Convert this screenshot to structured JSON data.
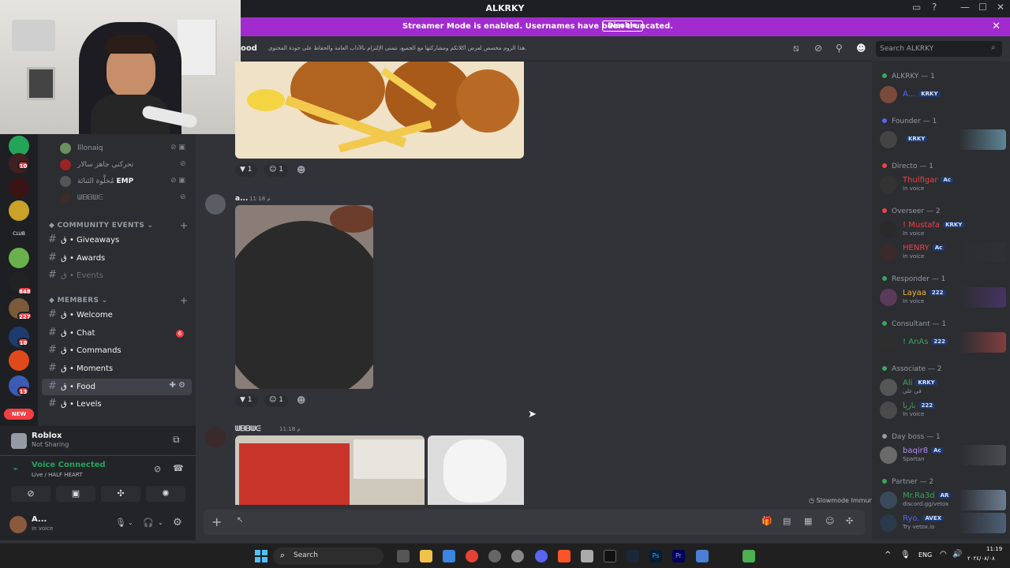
{
  "window": {
    "title": "ALKRKY"
  },
  "streamer_banner": {
    "text": "Streamer Mode is enabled. Usernames have been truncated.",
    "button": "Disable"
  },
  "channel_header": {
    "name": "ood",
    "topic": "هذا الروم مخصص لعرض أكلاتكم ومشاركتها مع الجميع، نتمنى الإلتزام بالآداب العامة والحفاظ على جودة المحتوى.",
    "search_placeholder": "Search ALKRKY"
  },
  "guild_badges": [
    "10",
    "848",
    "227",
    "18",
    "13"
  ],
  "guild_new": "NEW",
  "voice_users": [
    {
      "name": "lllonaiq"
    },
    {
      "name": "تحركني جاهز سالار"
    },
    {
      "name": "مُخلَّوة الثنائة",
      "tag": "EMP"
    },
    {
      "name": "ᗯᗷᗷᗯᕮ"
    }
  ],
  "categories": {
    "community": "COMMUNITY EVENTS",
    "members": "MEMBERS"
  },
  "community_channels": [
    {
      "name": "Giveaways"
    },
    {
      "name": "Awards"
    },
    {
      "name": "Events"
    }
  ],
  "member_channels": [
    {
      "name": "Welcome"
    },
    {
      "name": "Chat",
      "badge": "6"
    },
    {
      "name": "Commands"
    },
    {
      "name": "Moments"
    },
    {
      "name": "Food"
    },
    {
      "name": "Levels"
    }
  ],
  "channel_prefix": "ق •",
  "activity": {
    "game": "Roblox",
    "status": "Not Sharing"
  },
  "voice": {
    "status": "Voice Connected",
    "detail": "Live / HALF HEART"
  },
  "user_panel": {
    "name": "A...",
    "status": "In voice"
  },
  "messages": [
    {
      "author": "a...",
      "time": "11:18 م",
      "reactions": [
        "1",
        "1"
      ]
    },
    {
      "author": "ᗯᗷᗷᗯᕮ",
      "time": "11:18 م"
    }
  ],
  "first_reactions": [
    "1",
    "1"
  ],
  "composer": {
    "slowmode": "Slowmode Immune"
  },
  "member_groups": [
    {
      "label": "ALKRKY — 1",
      "color": "#3ba55d",
      "members": [
        {
          "name": "A...",
          "tag": "KRKY",
          "color": "#5865f2"
        }
      ]
    },
    {
      "label": "Founder — 1",
      "color": "#5865f2",
      "members": [
        {
          "name": "",
          "tag": "KRKY",
          "color": "#f2f3f5"
        }
      ]
    },
    {
      "label": "Directo — 1",
      "color": "#ed4245",
      "members": [
        {
          "name": "Thulfigar",
          "tag": "Ac",
          "status": "In voice",
          "color": "#ed4245"
        }
      ]
    },
    {
      "label": "Overseer — 2",
      "color": "#ed4245",
      "members": [
        {
          "name": "! Mustafa",
          "tag": "KRKY",
          "status": "In voice",
          "color": "#ed4245"
        },
        {
          "name": "HENRY",
          "tag": "Ac",
          "status": "In voice",
          "color": "#ed4245"
        }
      ]
    },
    {
      "label": "Responder — 1",
      "color": "#3ba55d",
      "members": [
        {
          "name": "Layaa",
          "tag": "222",
          "status": "In voice",
          "color": "#f0b232"
        }
      ]
    },
    {
      "label": "Consultant — 1",
      "color": "#3ba55d",
      "members": [
        {
          "name": "! AnAs",
          "tag": "222",
          "color": "#3ba55d"
        }
      ]
    },
    {
      "label": "Associate — 2",
      "color": "#3ba55d",
      "members": [
        {
          "name": "Ali",
          "tag": "KRKY",
          "status": "في علي",
          "color": "#3ba55d"
        },
        {
          "name": "باريا",
          "tag": "222",
          "status": "In voice",
          "color": "#3ba55d"
        }
      ]
    },
    {
      "label": "Day boss — 1",
      "color": "#949ba4",
      "members": [
        {
          "name": "baqir8",
          "tag": "Ac",
          "status": "Spartan",
          "color": "#b28af0"
        }
      ]
    },
    {
      "label": "Partner — 2",
      "color": "#3ba55d",
      "members": [
        {
          "name": "Mr.Ra3d",
          "tag": "AR",
          "status": "discord.gg/vetox",
          "color": "#3ba55d"
        },
        {
          "name": "Ryo.",
          "tag": "AVEX",
          "status": "Try vetox.io",
          "color": "#5865f2"
        }
      ]
    }
  ],
  "taskbar": {
    "search": "Search",
    "lang": "ENG",
    "time": "11:19",
    "date": "٢٠٢٤/٠٨/٠٨"
  },
  "colors": {
    "accent": "#a12bcf",
    "bg": "#313338",
    "sidebar": "#2b2d31"
  }
}
